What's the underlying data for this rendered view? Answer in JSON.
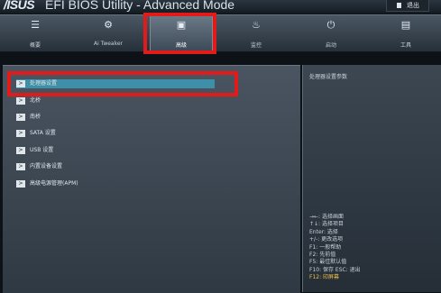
{
  "titlebar": {
    "brand": "/ISUS",
    "title": "EFI BIOS Utility - Advanced Mode",
    "exit_label": "退出"
  },
  "tabs": [
    {
      "label": "概要",
      "icon": "list-icon"
    },
    {
      "label": "Ai Tweaker",
      "icon": "tweaker-icon"
    },
    {
      "label": "高级",
      "icon": "advanced-icon"
    },
    {
      "label": "监控",
      "icon": "monitor-icon"
    },
    {
      "label": "启动",
      "icon": "power-icon"
    },
    {
      "label": "工具",
      "icon": "tools-icon"
    }
  ],
  "active_tab": "高级",
  "menu": [
    {
      "label": "处理器设置"
    },
    {
      "label": "北桥"
    },
    {
      "label": "南桥"
    },
    {
      "label": "SATA 设置"
    },
    {
      "label": "USB 设置"
    },
    {
      "label": "内置设备设置"
    },
    {
      "label": "高级电源管理(APM)"
    }
  ],
  "side": {
    "description": "处理器设置参数",
    "help": [
      "→←: 选择画面",
      "↑↓: 选择项目",
      "Enter: 选择",
      "+/-: 更改选项",
      "F1: 一般帮助",
      "F2: 先前值",
      "F5: 最佳默认值",
      "F10: 保存  ESC: 退出",
      "F12: 印屏幕"
    ]
  },
  "colors": {
    "highlight_box": "#e11a1a",
    "selected_row": "#3f8fa8",
    "help_accent": "#f2c14a"
  }
}
